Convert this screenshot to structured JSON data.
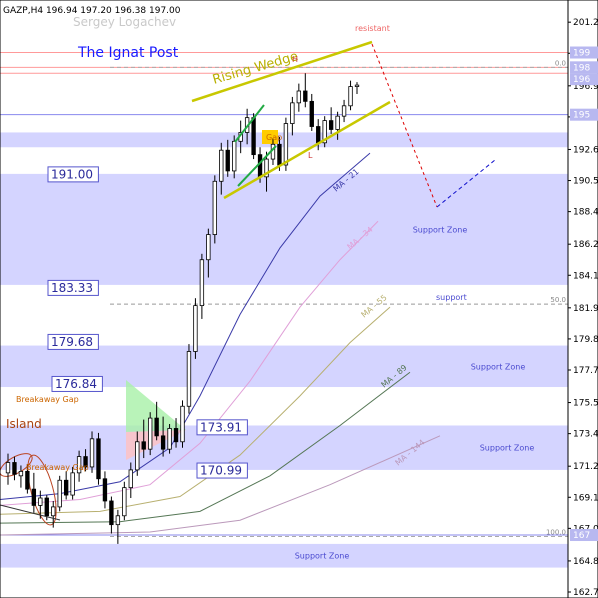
{
  "header": {
    "symbol_line": "GAZP,H4  196.94 197.20 196.38 197.00",
    "watermark": "Sergey Logachev",
    "brand": "The Ignat Post"
  },
  "colors": {
    "zone": "#ccccff",
    "wedge": "#c8c800",
    "channel": "#22aa44",
    "resistance": "#ff9999",
    "forecast_down": "#dd0000",
    "forecast_up": "#1010cc",
    "candle_bull": "#ffffff",
    "candle_bear": "#000000"
  },
  "chart_data": {
    "type": "candlestick",
    "ylim": [
      162.75,
      201.6
    ],
    "y_ticks": [
      "201.25",
      "199.15",
      "196.95",
      "194.85",
      "192.65",
      "190.55",
      "188.45",
      "186.25",
      "184.15",
      "181.95",
      "179.85",
      "177.75",
      "175.55",
      "173.45",
      "171.25",
      "169.15",
      "167.05",
      "164.85",
      "162.75"
    ],
    "price_tags": [
      "199",
      "198",
      "196",
      "195",
      "167"
    ],
    "fib_labels": [
      {
        "text": "100.0",
        "price": 166.5
      },
      {
        "text": "50.0",
        "price": 182.2
      },
      {
        "text": "0.0",
        "price": 198.2
      }
    ],
    "support_zones": [
      {
        "low": 183.5,
        "high": 191.0,
        "label": "Support Zone"
      },
      {
        "low": 176.6,
        "high": 179.4,
        "label": "Support Zone"
      },
      {
        "low": 171.0,
        "high": 174.0,
        "label": "Support Zone"
      },
      {
        "low": 164.4,
        "high": 166.0,
        "label": "Support Zone"
      },
      {
        "low": 192.8,
        "high": 193.8,
        "label": ""
      }
    ],
    "level_boxes": [
      {
        "text": "191.00",
        "price": 191.0
      },
      {
        "text": "183.33",
        "price": 183.33
      },
      {
        "text": "179.68",
        "price": 179.68
      },
      {
        "text": "176.84",
        "price": 176.84
      },
      {
        "text": "173.91",
        "price": 173.91
      },
      {
        "text": "170.99",
        "price": 170.99
      }
    ],
    "annotations": [
      {
        "text": "Rising Wedge"
      },
      {
        "text": "resistant"
      },
      {
        "text": "support"
      },
      {
        "text": "Gap"
      },
      {
        "text": "H"
      },
      {
        "text": "L"
      },
      {
        "text": "Breakaway Gap"
      },
      {
        "text": "Breakaway Gap"
      },
      {
        "text": "Island"
      }
    ],
    "ma_labels": [
      "MA - 21",
      "MA - 34",
      "MA - 55",
      "MA - 89",
      "MA - 144"
    ],
    "candles": [
      {
        "o": 170.8,
        "h": 172.1,
        "l": 170.0,
        "c": 171.5
      },
      {
        "o": 171.5,
        "h": 171.9,
        "l": 170.3,
        "c": 170.7
      },
      {
        "o": 170.6,
        "h": 171.3,
        "l": 169.8,
        "c": 170.9
      },
      {
        "o": 170.9,
        "h": 171.4,
        "l": 169.4,
        "c": 169.7
      },
      {
        "o": 169.7,
        "h": 170.8,
        "l": 168.1,
        "c": 168.6
      },
      {
        "o": 168.6,
        "h": 169.6,
        "l": 167.7,
        "c": 169.1
      },
      {
        "o": 169.1,
        "h": 169.3,
        "l": 167.6,
        "c": 167.9
      },
      {
        "o": 167.9,
        "h": 168.9,
        "l": 167.1,
        "c": 168.5
      },
      {
        "o": 168.5,
        "h": 170.6,
        "l": 168.2,
        "c": 170.3
      },
      {
        "o": 170.3,
        "h": 170.9,
        "l": 169.0,
        "c": 169.3
      },
      {
        "o": 169.3,
        "h": 171.2,
        "l": 169.0,
        "c": 170.8
      },
      {
        "o": 170.8,
        "h": 172.3,
        "l": 170.2,
        "c": 171.9
      },
      {
        "o": 171.9,
        "h": 172.4,
        "l": 170.9,
        "c": 171.2
      },
      {
        "o": 171.2,
        "h": 173.6,
        "l": 170.8,
        "c": 173.1
      },
      {
        "o": 173.1,
        "h": 173.5,
        "l": 170.0,
        "c": 170.4
      },
      {
        "o": 170.4,
        "h": 170.9,
        "l": 168.4,
        "c": 168.9
      },
      {
        "o": 168.9,
        "h": 169.2,
        "l": 166.7,
        "c": 167.3
      },
      {
        "o": 167.3,
        "h": 168.3,
        "l": 166.0,
        "c": 167.9
      },
      {
        "o": 167.9,
        "h": 170.2,
        "l": 167.6,
        "c": 169.8
      },
      {
        "o": 169.8,
        "h": 171.5,
        "l": 169.1,
        "c": 171.0
      },
      {
        "o": 171.0,
        "h": 173.6,
        "l": 170.6,
        "c": 172.9
      },
      {
        "o": 172.9,
        "h": 174.4,
        "l": 171.8,
        "c": 172.4
      },
      {
        "o": 172.4,
        "h": 174.9,
        "l": 172.0,
        "c": 174.5
      },
      {
        "o": 174.5,
        "h": 175.6,
        "l": 173.0,
        "c": 173.3
      },
      {
        "o": 173.3,
        "h": 174.6,
        "l": 171.9,
        "c": 172.4
      },
      {
        "o": 172.4,
        "h": 174.1,
        "l": 172.1,
        "c": 173.8
      },
      {
        "o": 173.8,
        "h": 174.5,
        "l": 172.5,
        "c": 172.9
      },
      {
        "o": 172.9,
        "h": 175.7,
        "l": 172.5,
        "c": 175.3
      },
      {
        "o": 175.3,
        "h": 179.5,
        "l": 174.8,
        "c": 179.0
      },
      {
        "o": 179.0,
        "h": 182.6,
        "l": 178.5,
        "c": 182.1
      },
      {
        "o": 182.1,
        "h": 185.6,
        "l": 181.2,
        "c": 185.2
      },
      {
        "o": 185.2,
        "h": 187.3,
        "l": 184.0,
        "c": 186.9
      },
      {
        "o": 186.9,
        "h": 190.9,
        "l": 186.3,
        "c": 190.5
      },
      {
        "o": 190.5,
        "h": 193.1,
        "l": 189.6,
        "c": 192.6
      },
      {
        "o": 192.6,
        "h": 193.3,
        "l": 190.8,
        "c": 191.2
      },
      {
        "o": 191.2,
        "h": 193.6,
        "l": 190.7,
        "c": 193.2
      },
      {
        "o": 193.2,
        "h": 194.6,
        "l": 192.4,
        "c": 193.8
      },
      {
        "o": 193.8,
        "h": 195.4,
        "l": 193.0,
        "c": 194.8
      },
      {
        "o": 194.8,
        "h": 195.1,
        "l": 192.0,
        "c": 192.3
      },
      {
        "o": 192.3,
        "h": 192.8,
        "l": 190.4,
        "c": 190.8
      },
      {
        "o": 190.8,
        "h": 192.5,
        "l": 189.8,
        "c": 192.0
      },
      {
        "o": 192.0,
        "h": 193.4,
        "l": 191.6,
        "c": 193.0
      },
      {
        "o": 193.0,
        "h": 193.5,
        "l": 191.2,
        "c": 191.6
      },
      {
        "o": 191.6,
        "h": 194.8,
        "l": 191.2,
        "c": 194.4
      },
      {
        "o": 194.4,
        "h": 196.2,
        "l": 193.6,
        "c": 195.8
      },
      {
        "o": 195.8,
        "h": 197.1,
        "l": 195.2,
        "c": 196.6
      },
      {
        "o": 196.6,
        "h": 197.8,
        "l": 195.5,
        "c": 195.9
      },
      {
        "o": 195.9,
        "h": 196.4,
        "l": 193.9,
        "c": 194.2
      },
      {
        "o": 194.2,
        "h": 194.7,
        "l": 192.6,
        "c": 193.1
      },
      {
        "o": 193.1,
        "h": 194.9,
        "l": 192.8,
        "c": 194.6
      },
      {
        "o": 194.6,
        "h": 195.5,
        "l": 193.7,
        "c": 194.0
      },
      {
        "o": 194.0,
        "h": 195.2,
        "l": 193.3,
        "c": 194.9
      },
      {
        "o": 194.9,
        "h": 196.0,
        "l": 194.5,
        "c": 195.6
      },
      {
        "o": 195.6,
        "h": 197.3,
        "l": 195.3,
        "c": 196.9
      },
      {
        "o": 196.9,
        "h": 197.2,
        "l": 196.4,
        "c": 197.0
      }
    ]
  }
}
